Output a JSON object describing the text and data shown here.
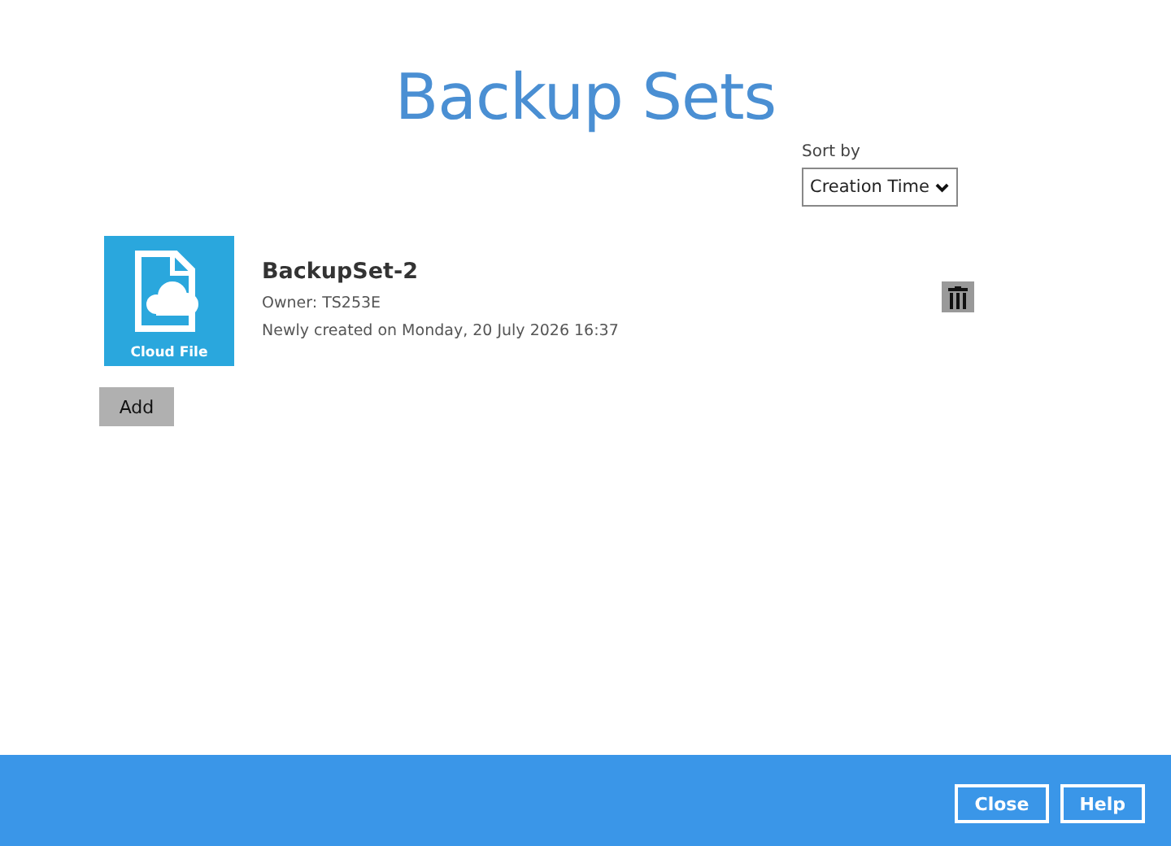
{
  "title": "Backup Sets",
  "sort": {
    "label": "Sort by",
    "value": "Creation Time"
  },
  "backup_sets": [
    {
      "name": "BackupSet-2",
      "type_label": "Cloud File",
      "owner": "Owner: TS253E",
      "created": "Newly created on Monday, 20 July 2026 16:37"
    }
  ],
  "add_button": "Add",
  "footer_buttons": [
    "Close",
    "Help"
  ]
}
